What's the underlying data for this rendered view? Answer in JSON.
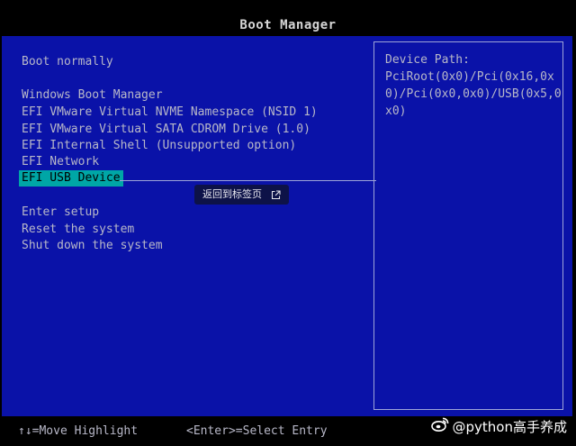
{
  "header": {
    "title": "Boot Manager"
  },
  "menu": {
    "items": [
      {
        "label": "Boot normally"
      },
      {
        "label": "Windows Boot Manager"
      },
      {
        "label": "EFI VMware Virtual NVME Namespace (NSID 1)"
      },
      {
        "label": "EFI VMware Virtual SATA CDROM Drive (1.0)"
      },
      {
        "label": "EFI Internal Shell (Unsupported option)"
      },
      {
        "label": "EFI Network"
      },
      {
        "label": "EFI USB Device",
        "selected": true
      },
      {
        "label": "Enter setup"
      },
      {
        "label": "Reset the system"
      },
      {
        "label": "Shut down the system"
      }
    ]
  },
  "side_panel": {
    "label": "Device Path:",
    "path": "PciRoot(0x0)/Pci(0x16,0x0)/Pci(0x0,0x0)/USB(0x5,0x0)"
  },
  "tooltip": {
    "text": "返回到标签页",
    "icon": "external-link-icon"
  },
  "footer": {
    "move_hint": "↑↓=Move Highlight",
    "select_hint": "<Enter>=Select Entry"
  },
  "watermark": {
    "text": "@python高手养成",
    "icon": "weibo-logo-icon"
  },
  "colors": {
    "panel_bg": "#0a12a8",
    "text": "#b8b8c8",
    "highlight": "#00a6a6",
    "border": "#9ea4d8"
  }
}
